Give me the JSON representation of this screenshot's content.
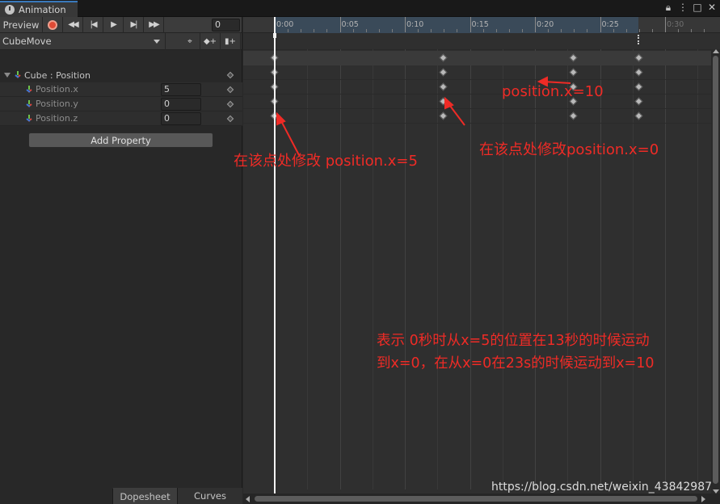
{
  "window": {
    "tab_label": "Animation",
    "buttons": [
      "lock-icon",
      "menu-icon",
      "maximize-icon",
      "close-icon"
    ]
  },
  "toolbar": {
    "preview_label": "Preview",
    "frame_value": "0",
    "clip_name": "CubeMove"
  },
  "properties": {
    "group_label": "Cube : Position",
    "items": [
      {
        "label": "Position.x",
        "value": "5"
      },
      {
        "label": "Position.y",
        "value": "0"
      },
      {
        "label": "Position.z",
        "value": "0"
      }
    ],
    "add_property_label": "Add Property"
  },
  "bottom_tabs": {
    "dopesheet": "Dopesheet",
    "curves": "Curves"
  },
  "ruler_labels": [
    "0:00",
    "0:05",
    "0:10",
    "0:15",
    "0:20",
    "0:25",
    "0:30"
  ],
  "keyframe_times": [
    "0:00",
    "0:13",
    "0:23",
    "0:28"
  ],
  "annotations": {
    "at_start": "在该点处修改 position.x=5",
    "at_mid": "在该点处修改position.x=0",
    "at_late": "position.x=10",
    "summary_line1": "表示 0秒时从x=5的位置在13秒的时候运动",
    "summary_line2": "到x=0，在从x=0在23s的时候运动到x=10"
  },
  "watermark": "https://blog.csdn.net/weixin_43842987",
  "colors": {
    "accent_tab": "#3a79bb",
    "record": "#e04a35",
    "annotation": "#ef2b26",
    "playhead": "#f2f2f2"
  }
}
